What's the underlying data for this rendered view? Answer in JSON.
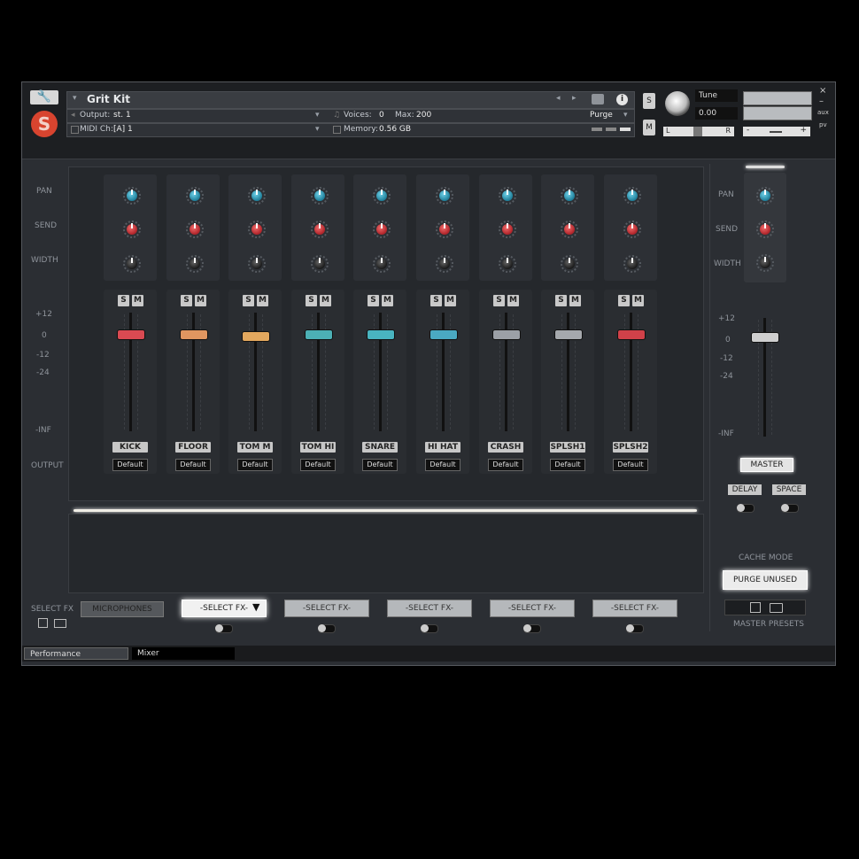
{
  "header": {
    "instrument_name": "Grit Kit",
    "output_label": "Output:",
    "output_value": "st. 1",
    "midi_label": "MIDI Ch:",
    "midi_value": "[A] 1",
    "voices_label": "Voices:",
    "voices_value": "0",
    "max_label": "Max:",
    "max_value": "200",
    "memory_label": "Memory:",
    "memory_value": "0.56 GB",
    "purge_label": "Purge",
    "solo_label": "S",
    "mute_label": "M",
    "tune_label": "Tune",
    "tune_value": "0.00",
    "pan_left": "L",
    "pan_right": "R",
    "vol_minus": "-",
    "vol_plus": "+",
    "aux_label": "aux",
    "pv_label": "pv",
    "close_label": "×",
    "minimize_label": "–"
  },
  "row_labels": {
    "pan": "PAN",
    "send": "SEND",
    "width": "WIDTH",
    "db_p12": "+12",
    "db_0": "0",
    "db_m12": "-12",
    "db_m24": "-24",
    "db_inf": "-INF",
    "output": "OUTPUT"
  },
  "channels": [
    {
      "name": "KICK",
      "output": "Default",
      "cap_color": "#d94a52"
    },
    {
      "name": "FLOOR",
      "output": "Default",
      "cap_color": "#e09660"
    },
    {
      "name": "TOM M",
      "output": "Default",
      "cap_color": "#e3a85e"
    },
    {
      "name": "TOM HI",
      "output": "Default",
      "cap_color": "#4cb0b5"
    },
    {
      "name": "SNARE",
      "output": "Default",
      "cap_color": "#49b4c0"
    },
    {
      "name": "HI HAT",
      "output": "Default",
      "cap_color": "#4aa9c2"
    },
    {
      "name": "CRASH",
      "output": "Default",
      "cap_color": "#9ca0a6"
    },
    {
      "name": "SPLSH1",
      "output": "Default",
      "cap_color": "#a6a9ad"
    },
    {
      "name": "SPLSH2",
      "output": "Default",
      "cap_color": "#d14149"
    }
  ],
  "channel_buttons": {
    "solo": "S",
    "mute": "M"
  },
  "master": {
    "pan": "PAN",
    "send": "SEND",
    "width": "WIDTH",
    "db_p12": "+12",
    "db_0": "0",
    "db_m12": "-12",
    "db_m24": "-24",
    "db_inf": "-INF",
    "master_button": "MASTER",
    "delay_button": "DELAY",
    "space_button": "SPACE",
    "cache_mode_label": "CACHE MODE",
    "purge_unused_button": "PURGE UNUSED",
    "master_presets_label": "MASTER PRESETS"
  },
  "fx": {
    "select_fx_label": "SELECT FX",
    "microphones_button": "MICROPHONES",
    "slots": [
      "-SELECT FX-",
      "-SELECT FX-",
      "-SELECT FX-",
      "-SELECT FX-",
      "-SELECT FX-"
    ]
  },
  "tabs": {
    "performance": "Performance",
    "mixer": "Mixer"
  }
}
